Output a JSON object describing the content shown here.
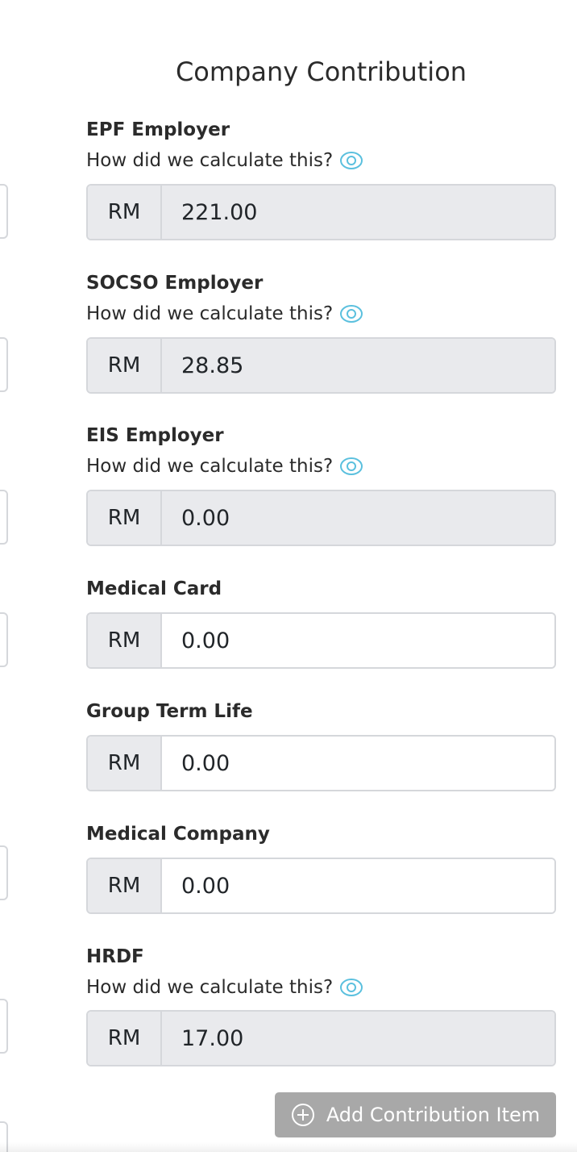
{
  "section": {
    "title": "Company Contribution"
  },
  "currency": "RM",
  "calc_hint": "How did we calculate this?",
  "items": {
    "epf": {
      "label": "EPF Employer",
      "value": "221.00"
    },
    "socso": {
      "label": "SOCSO Employer",
      "value": "28.85"
    },
    "eis": {
      "label": "EIS Employer",
      "value": "0.00"
    },
    "medical_card": {
      "label": "Medical Card",
      "value": "0.00"
    },
    "group_term_life": {
      "label": "Group Term Life",
      "value": "0.00"
    },
    "medical_company": {
      "label": "Medical Company",
      "value": "0.00"
    },
    "hrdf": {
      "label": "HRDF",
      "value": "17.00"
    }
  },
  "add_button": {
    "label": "Add Contribution Item"
  },
  "colors": {
    "eye_icon": "#5bc0de",
    "readonly_bg": "#e9eaed",
    "button_bg": "#a8a8a8"
  },
  "icons": {
    "eye": "eye-icon",
    "plus": "plus-circle-icon"
  }
}
